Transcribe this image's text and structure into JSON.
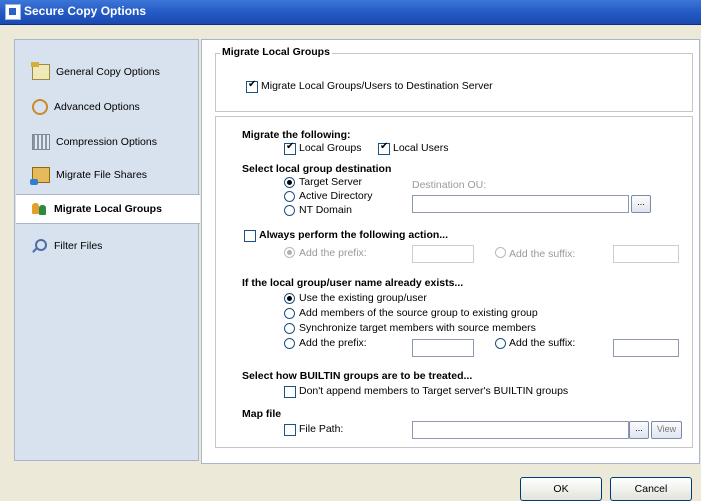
{
  "window": {
    "title": "Secure Copy Options"
  },
  "sidebar": {
    "items": [
      {
        "label": "General Copy Options",
        "icon": "general-options-icon"
      },
      {
        "label": "Advanced Options",
        "icon": "advanced-options-icon"
      },
      {
        "label": "Compression Options",
        "icon": "compression-icon"
      },
      {
        "label": "Migrate File Shares",
        "icon": "file-shares-icon"
      },
      {
        "label": "Migrate Local Groups",
        "icon": "local-groups-icon",
        "selected": true
      },
      {
        "label": "Filter Files",
        "icon": "filter-icon"
      }
    ]
  },
  "migrate_group": {
    "title": "Migrate Local Groups",
    "main_checkbox": {
      "label": "Migrate Local Groups/Users to Destination Server",
      "checked": true
    }
  },
  "migrate_following": {
    "heading": "Migrate the following:",
    "local_groups": {
      "label": "Local Groups",
      "checked": true
    },
    "local_users": {
      "label": "Local Users",
      "checked": true
    }
  },
  "destination": {
    "heading": "Select local group destination",
    "options": [
      "Target Server",
      "Active Directory",
      "NT Domain"
    ],
    "selected": "Target Server",
    "ou_label": "Destination OU:",
    "browse_label": "..."
  },
  "always_perform": {
    "label": "Always perform the following action...",
    "checked": false,
    "prefix_label": "Add the prefix:",
    "suffix_label": "Add the suffix:"
  },
  "exists": {
    "heading": "If the local group/user name already exists...",
    "options": [
      "Use the existing group/user",
      "Add members of the source group to existing group",
      "Synchronize target members with source members",
      "Add the prefix:"
    ],
    "selected": "Use the existing group/user",
    "suffix_label": "Add the suffix:"
  },
  "builtin": {
    "heading": "Select how BUILTIN groups are to be treated...",
    "checkbox": {
      "label": "Don't append members to Target server's BUILTIN groups",
      "checked": false
    }
  },
  "map_file": {
    "heading": "Map file",
    "checkbox": {
      "label": "File Path:",
      "checked": false
    },
    "browse_label": "...",
    "view_label": "View"
  },
  "footer": {
    "ok_label": "OK",
    "cancel_label": "Cancel"
  }
}
